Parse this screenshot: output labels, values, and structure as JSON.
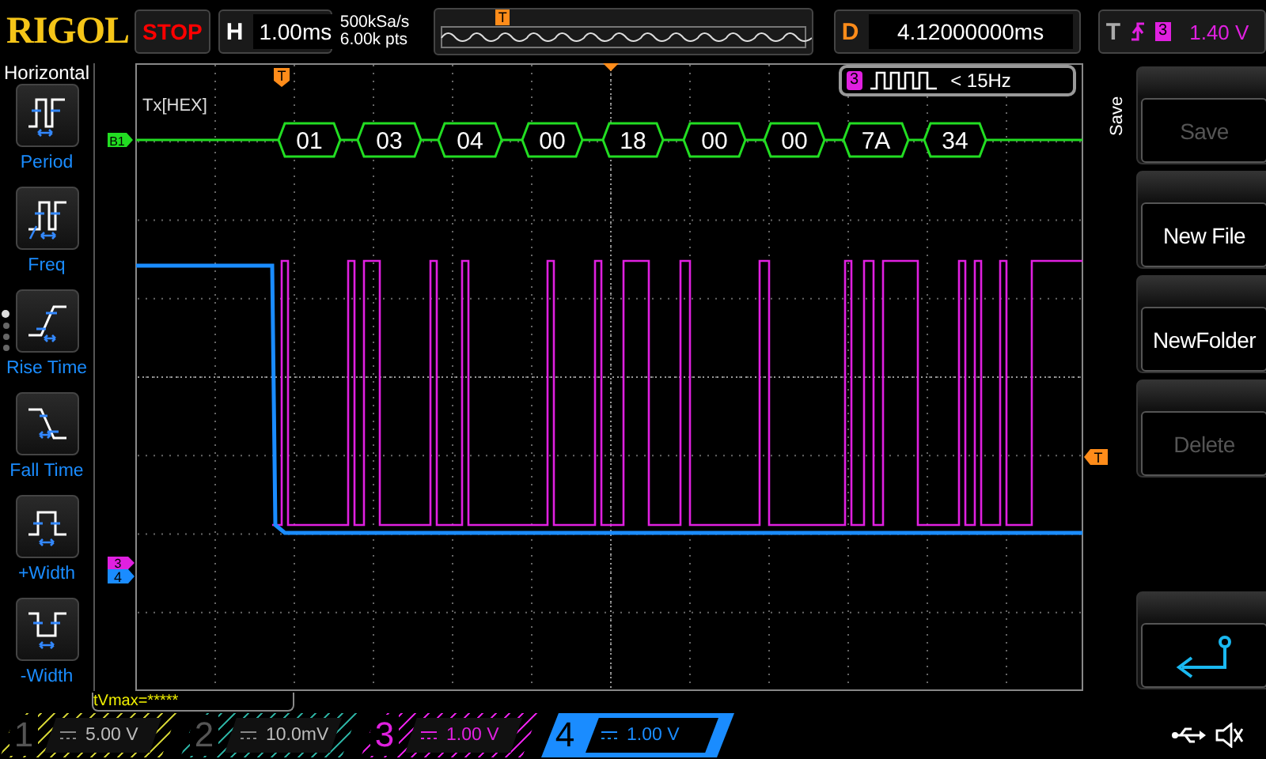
{
  "brand": "RIGOL",
  "run_state": "STOP",
  "horizontal": {
    "label": "H",
    "timebase": "1.00ms"
  },
  "sample": {
    "rate": "500kSa/s",
    "depth": "6.00k pts"
  },
  "overview": {
    "trigger_marker": "T"
  },
  "delay": {
    "label": "D",
    "value": "4.12000000ms"
  },
  "trigger": {
    "label": "T",
    "source": "3",
    "level": "1.40 V"
  },
  "measure_menu": {
    "title": "Horizontal",
    "items": [
      {
        "label": "Period",
        "kind": "period"
      },
      {
        "label": "Freq",
        "kind": "freq"
      },
      {
        "label": "Rise Time",
        "kind": "rise"
      },
      {
        "label": "Fall Time",
        "kind": "fall"
      },
      {
        "label": "+Width",
        "kind": "pwidth"
      },
      {
        "label": "-Width",
        "kind": "nwidth"
      }
    ],
    "pages": [
      {
        "selected": true
      },
      {
        "selected": false
      },
      {
        "selected": false
      },
      {
        "selected": false
      }
    ]
  },
  "decode": {
    "label": "Tx[HEX]",
    "bus": "B1",
    "packets": [
      "01",
      "03",
      "04",
      "00",
      "18",
      "00",
      "00",
      "7A",
      "34"
    ]
  },
  "frequency_counter": {
    "channel": "3",
    "value": "< 15Hz"
  },
  "markers": {
    "trigger_position": "T",
    "trigger_level": "T",
    "channels": [
      "3",
      "4"
    ]
  },
  "measurement": "tVmax=*****",
  "save_menu": {
    "title": "Save",
    "buttons": [
      {
        "kind": "text",
        "label": "Save",
        "disabled": true
      },
      {
        "kind": "text",
        "label": "New File",
        "disabled": false
      },
      {
        "kind": "text",
        "label": "NewFolder",
        "disabled": false
      },
      {
        "kind": "text",
        "label": "Delete",
        "disabled": true
      },
      {
        "kind": "back",
        "disabled": false
      }
    ]
  },
  "channels": [
    {
      "number": "1",
      "scale": "5.00 V",
      "on": false,
      "selected": false,
      "color": "#c8c832"
    },
    {
      "number": "2",
      "scale": "10.0mV",
      "on": false,
      "selected": false,
      "color": "#2aa89a"
    },
    {
      "number": "3",
      "scale": "1.00 V",
      "on": true,
      "selected": false,
      "color": "#e020e0"
    },
    {
      "number": "4",
      "scale": "1.00 V",
      "on": true,
      "selected": true,
      "color": "#1a8cff"
    }
  ]
}
